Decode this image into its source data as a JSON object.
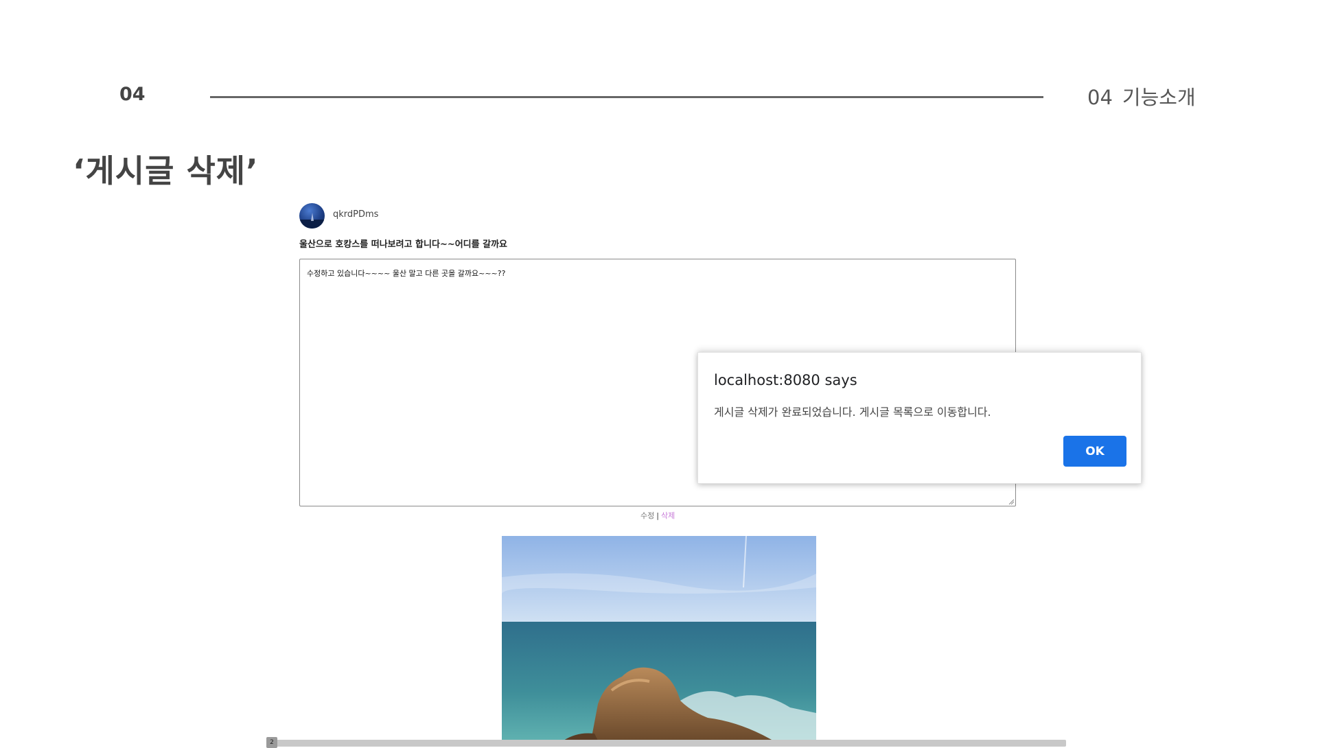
{
  "slide": {
    "section_number": "04",
    "header_number": "04",
    "header_label": "기능소개",
    "title": "‘게시글 삭제’"
  },
  "post": {
    "username": "qkrdPDms",
    "title": "울산으로 호캉스를 떠나보려고 합니다~~어디를 갈까요",
    "content": "수정하고 있습니다~~~~ 울산 말고 다른 곳을 갈까요~~~??",
    "edit_label": "수정",
    "separator": "|",
    "delete_label": "삭제"
  },
  "scrollbar": {
    "thumb_label": "2"
  },
  "dialog": {
    "origin": "localhost:8080 says",
    "message": "게시글 삭제가 완료되었습니다. 게시글 목록으로 이동합니다.",
    "ok_label": "OK"
  },
  "colors": {
    "ok_button": "#1a73e8",
    "delete_link": "#c77ad8"
  }
}
